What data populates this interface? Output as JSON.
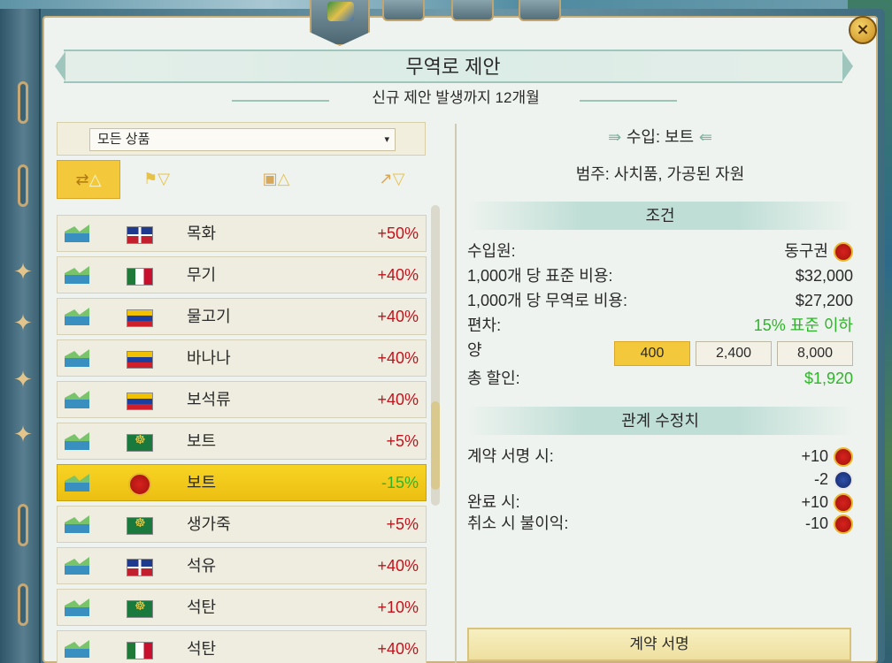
{
  "window": {
    "title": "무역로 제안",
    "subtitle": "신규 제안 발생까지 12개월",
    "close_label": "×"
  },
  "filter": {
    "selected": "모든 상품"
  },
  "sort": {
    "trade_route_icon": "trade-route-icon",
    "flag_icon": "flag-icon",
    "resource_icon": "resource-box-icon",
    "trend_icon": "trend-arrow-icon"
  },
  "goods": [
    {
      "name": "목화",
      "pct": "+50%",
      "flag": "dominican"
    },
    {
      "name": "무기",
      "pct": "+40%",
      "flag": "mexico"
    },
    {
      "name": "물고기",
      "pct": "+40%",
      "flag": "venezuela"
    },
    {
      "name": "바나나",
      "pct": "+40%",
      "flag": "venezuela"
    },
    {
      "name": "보석류",
      "pct": "+40%",
      "flag": "venezuela"
    },
    {
      "name": "보트",
      "pct": "+5%",
      "flag": "green-emblem"
    },
    {
      "name": "보트",
      "pct": "-15%",
      "flag": "soviet",
      "selected": true
    },
    {
      "name": "생가죽",
      "pct": "+5%",
      "flag": "green-emblem"
    },
    {
      "name": "석유",
      "pct": "+40%",
      "flag": "dominican"
    },
    {
      "name": "석탄",
      "pct": "+10%",
      "flag": "green-emblem"
    },
    {
      "name": "석탄",
      "pct": "+40%",
      "flag": "mexico"
    }
  ],
  "detail": {
    "title": "수입: 보트",
    "category": "범주: 사치품, 가공된 자원",
    "conditions_header": "조건",
    "source_label": "수입원:",
    "source_value": "동구권",
    "std_cost_label": "1,000개 당 표준 비용:",
    "std_cost_value": "$32,000",
    "trade_cost_label": "1,000개 당 무역로 비용:",
    "trade_cost_value": "$27,200",
    "deviation_label": "편차:",
    "deviation_value": "15% 표준 이하",
    "quantity_label": "양",
    "quantities": [
      "400",
      "2,400",
      "8,000"
    ],
    "total_discount_label": "총 할인:",
    "total_discount_value": "$1,920",
    "relations_header": "관계 수정치",
    "on_sign_label": "계약 서명 시:",
    "on_sign_values": [
      "+10",
      "-2"
    ],
    "on_complete_label": "완료 시:",
    "on_complete_value": "+10",
    "on_cancel_label": "취소 시 불이익:",
    "on_cancel_value": "-10",
    "sign_button": "계약 서명"
  },
  "colors": {
    "accent_gold": "#f3c93b",
    "negative_red": "#c2121c",
    "positive_green": "#2fb52a"
  }
}
